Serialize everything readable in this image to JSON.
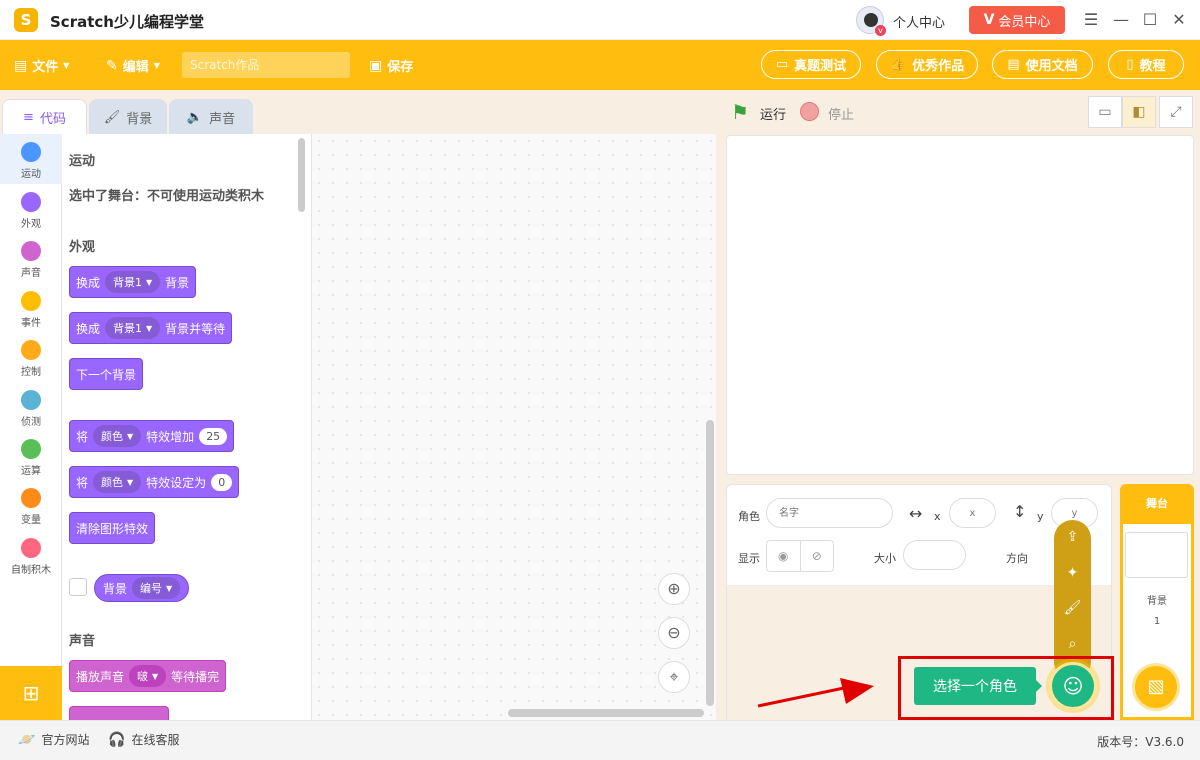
{
  "titlebar": {
    "app_title": "Scratch少儿编程学堂",
    "logo_letter": "S",
    "user_center": "个人中心",
    "vip_mark": "V",
    "vip_label": "会员中心"
  },
  "toolbar": {
    "file_label": "文件",
    "edit_label": "编辑",
    "project_placeholder": "Scratch作品",
    "save_label": "保存",
    "exam_label": "真题测试",
    "showcase_label": "优秀作品",
    "docs_label": "使用文档",
    "tutorial_label": "教程"
  },
  "editor_tabs": [
    "代码",
    "背景",
    "声音"
  ],
  "categories": [
    {
      "label": "运动",
      "color": "#4c97ff"
    },
    {
      "label": "外观",
      "color": "#9966ff"
    },
    {
      "label": "声音",
      "color": "#cf63cf"
    },
    {
      "label": "事件",
      "color": "#ffbf00"
    },
    {
      "label": "控制",
      "color": "#ffab19"
    },
    {
      "label": "侦测",
      "color": "#5cb1d6"
    },
    {
      "label": "运算",
      "color": "#59c059"
    },
    {
      "label": "变量",
      "color": "#ff8c1a"
    },
    {
      "label": "自制积木",
      "color": "#ff6680"
    }
  ],
  "palette": {
    "motion_title": "运动",
    "motion_note": "选中了舞台：不可使用运动类积木",
    "looks_title": "外观",
    "blocks": {
      "switch_backdrop": {
        "prefix": "换成",
        "menu": "背景1",
        "suffix": "背景"
      },
      "switch_backdrop_wait": {
        "prefix": "换成",
        "menu": "背景1",
        "suffix": "背景并等待"
      },
      "next_backdrop": "下一个背景",
      "change_effect": {
        "prefix": "将",
        "menu": "颜色",
        "middle": "特效增加",
        "value": "25"
      },
      "set_effect": {
        "prefix": "将",
        "menu": "颜色",
        "middle": "特效设定为",
        "value": "0"
      },
      "clear_effects": "清除图形特效",
      "backdrop_reporter": {
        "label": "背景",
        "menu": "编号"
      }
    },
    "sound_title": "声音",
    "play_sound": {
      "prefix": "播放声音",
      "menu": "啵",
      "suffix": "等待播完"
    }
  },
  "stage_controls": {
    "run_label": "运行",
    "stop_label": "停止"
  },
  "sprite_info": {
    "sprite_label": "角色",
    "name_placeholder": "名字",
    "x_label": "x",
    "x_placeholder": "x",
    "y_label": "y",
    "y_placeholder": "y",
    "show_label": "显示",
    "size_label": "大小",
    "direction_label": "方向"
  },
  "choose_sprite_label": "选择一个角色",
  "stage_panel": {
    "title": "舞台",
    "backdrop_label": "背景",
    "backdrop_count": "1"
  },
  "statusbar": {
    "website": "官方网站",
    "support": "在线客服",
    "version": "版本号：V3.6.0"
  },
  "colors": {
    "toolbar": "#ffbd0f",
    "accent_green": "#1fb783",
    "highlight_box": "#e10000"
  }
}
